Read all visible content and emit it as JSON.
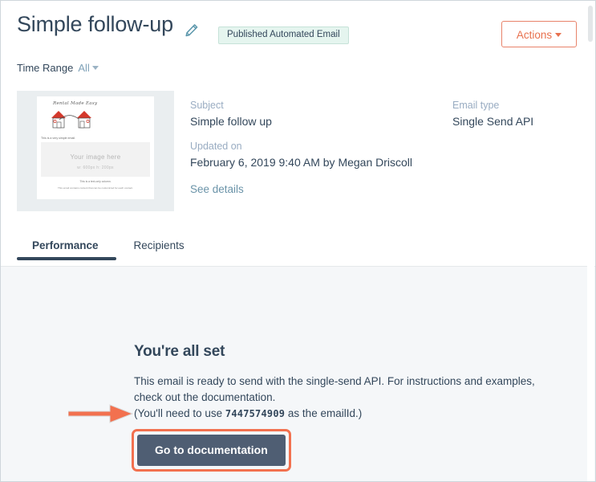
{
  "header": {
    "title": "Simple follow-up",
    "edit_icon": "pencil-icon",
    "status_badge": "Published Automated Email",
    "actions_label": "Actions"
  },
  "filters": {
    "time_range_label": "Time Range",
    "time_range_value": "All"
  },
  "thumbnail": {
    "logo_text": "Rental Made Easy",
    "intro_line": "This is a very simple email.",
    "image_placeholder_title": "Your image here",
    "image_placeholder_size": "w: 600px  h: 200px",
    "footer_line1": "This is a text-only column.",
    "footer_line2": "This email contains content that can be customized for each contact."
  },
  "details": {
    "subject_label": "Subject",
    "subject_value": "Simple follow up",
    "updated_label": "Updated on",
    "updated_value": "February 6, 2019 9:40 AM by Megan Driscoll",
    "see_details_label": "See details",
    "email_type_label": "Email type",
    "email_type_value": "Single Send API"
  },
  "tabs": [
    {
      "label": "Performance",
      "active": true
    },
    {
      "label": "Recipients",
      "active": false
    }
  ],
  "main": {
    "heading": "You're all set",
    "body_line1": "This email is ready to send with the single-send API. For instructions and examples, check out the",
    "body_line2": "documentation.",
    "emailid_prefix": "(You'll need to use ",
    "emailid_value": "7447574909",
    "emailid_suffix": " as the emailId.)",
    "cta_label": "Go to documentation"
  },
  "annotation": {
    "arrow": "right-arrow-annotation"
  },
  "colors": {
    "accent_orange": "#f2714f",
    "actions_orange": "#e8714e",
    "navy": "#33475b",
    "button_navy": "#4f5e73",
    "badge_green_bg": "#e5f5ef",
    "badge_green_border": "#c6e2d8",
    "link_blue": "#6a93a8",
    "page_gray": "#f5f7f9"
  }
}
